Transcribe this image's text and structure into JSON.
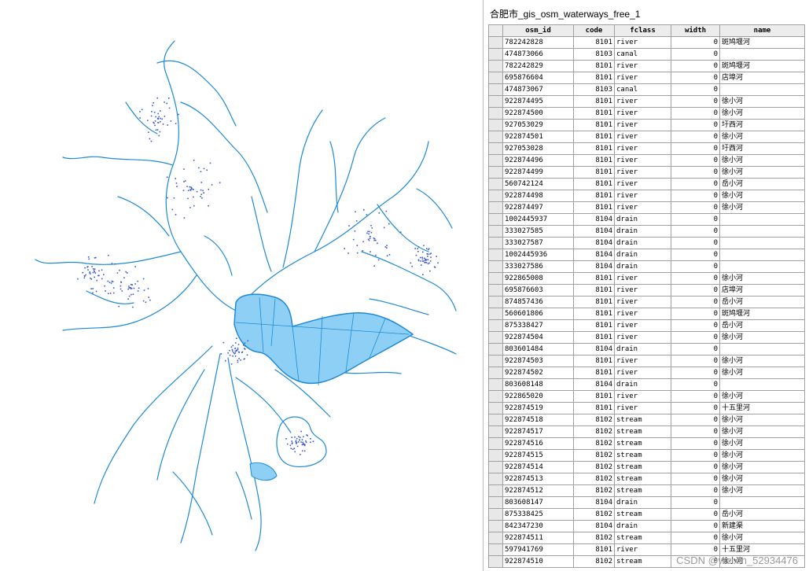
{
  "map": {
    "water_color": "#1e8ad6",
    "lake_fill": "#8ed0f5",
    "lake_stroke": "#1e8ad6"
  },
  "table": {
    "title": "合肥市_gis_osm_waterways_free_1",
    "columns": [
      "osm_id",
      "code",
      "fclass",
      "width",
      "name"
    ],
    "rows": [
      [
        "782242828",
        "8101",
        "river",
        "0",
        "斑鸠堰河"
      ],
      [
        "474873066",
        "8103",
        "canal",
        "0",
        ""
      ],
      [
        "782242829",
        "8101",
        "river",
        "0",
        "斑鸠堰河"
      ],
      [
        "695876604",
        "8101",
        "river",
        "0",
        "店埠河"
      ],
      [
        "474873067",
        "8103",
        "canal",
        "0",
        ""
      ],
      [
        "922874495",
        "8101",
        "river",
        "0",
        "徐小河"
      ],
      [
        "922874500",
        "8101",
        "river",
        "0",
        "徐小河"
      ],
      [
        "927053029",
        "8101",
        "river",
        "0",
        "圩西河"
      ],
      [
        "922874501",
        "8101",
        "river",
        "0",
        "徐小河"
      ],
      [
        "927053028",
        "8101",
        "river",
        "0",
        "圩西河"
      ],
      [
        "922874496",
        "8101",
        "river",
        "0",
        "徐小河"
      ],
      [
        "922874499",
        "8101",
        "river",
        "0",
        "徐小河"
      ],
      [
        "560742124",
        "8101",
        "river",
        "0",
        "岳小河"
      ],
      [
        "922874498",
        "8101",
        "river",
        "0",
        "徐小河"
      ],
      [
        "922874497",
        "8101",
        "river",
        "0",
        "徐小河"
      ],
      [
        "1002445937",
        "8104",
        "drain",
        "0",
        ""
      ],
      [
        "333027585",
        "8104",
        "drain",
        "0",
        ""
      ],
      [
        "333027587",
        "8104",
        "drain",
        "0",
        ""
      ],
      [
        "1002445936",
        "8104",
        "drain",
        "0",
        ""
      ],
      [
        "333027586",
        "8104",
        "drain",
        "0",
        ""
      ],
      [
        "922865008",
        "8101",
        "river",
        "0",
        "徐小河"
      ],
      [
        "695876603",
        "8101",
        "river",
        "0",
        "店埠河"
      ],
      [
        "874857436",
        "8101",
        "river",
        "0",
        "岳小河"
      ],
      [
        "560601806",
        "8101",
        "river",
        "0",
        "斑鸠堰河"
      ],
      [
        "875338427",
        "8101",
        "river",
        "0",
        "岳小河"
      ],
      [
        "922874504",
        "8101",
        "river",
        "0",
        "徐小河"
      ],
      [
        "803601484",
        "8104",
        "drain",
        "0",
        ""
      ],
      [
        "922874503",
        "8101",
        "river",
        "0",
        "徐小河"
      ],
      [
        "922874502",
        "8101",
        "river",
        "0",
        "徐小河"
      ],
      [
        "803608148",
        "8104",
        "drain",
        "0",
        ""
      ],
      [
        "922865020",
        "8101",
        "river",
        "0",
        "徐小河"
      ],
      [
        "922874519",
        "8101",
        "river",
        "0",
        "十五里河"
      ],
      [
        "922874518",
        "8102",
        "stream",
        "0",
        "徐小河"
      ],
      [
        "922874517",
        "8102",
        "stream",
        "0",
        "徐小河"
      ],
      [
        "922874516",
        "8102",
        "stream",
        "0",
        "徐小河"
      ],
      [
        "922874515",
        "8102",
        "stream",
        "0",
        "徐小河"
      ],
      [
        "922874514",
        "8102",
        "stream",
        "0",
        "徐小河"
      ],
      [
        "922874513",
        "8102",
        "stream",
        "0",
        "徐小河"
      ],
      [
        "922874512",
        "8102",
        "stream",
        "0",
        "徐小河"
      ],
      [
        "803608147",
        "8104",
        "drain",
        "0",
        ""
      ],
      [
        "875338425",
        "8102",
        "stream",
        "0",
        "岳小河"
      ],
      [
        "842347230",
        "8104",
        "drain",
        "0",
        "新建渠"
      ],
      [
        "922874511",
        "8102",
        "stream",
        "0",
        "徐小河"
      ],
      [
        "597941769",
        "8101",
        "river",
        "0",
        "十五里河"
      ],
      [
        "922874510",
        "8102",
        "stream",
        "0",
        "徐小河"
      ]
    ]
  },
  "watermark": "CSDN @weixin_52934476"
}
